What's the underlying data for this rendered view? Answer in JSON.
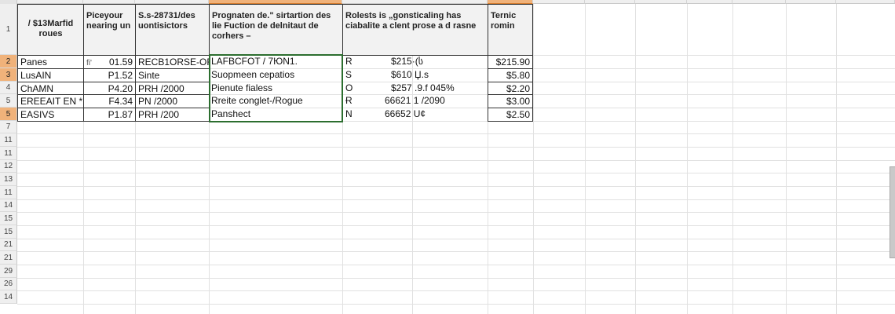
{
  "header_row": {
    "a": "/ $13Marfid roues",
    "b": "Piceyour nearing un",
    "c": "S.s-28731/des uontisictors",
    "d": "Prognaten de.\" sirtartion des lie Fuction de delnitaut de corhers –",
    "e": "Rolests is „gonsticaling has ciabalite a clent prose a d rasne",
    "f": "Ternic romin"
  },
  "row_numbers": [
    "1",
    "2",
    "3",
    "4",
    "5",
    "5",
    "7",
    "11",
    "11",
    "12",
    "13",
    "11",
    "14",
    "15",
    "15",
    "21",
    "21",
    "29",
    "26",
    "14"
  ],
  "rows": [
    {
      "a": "Panes",
      "b1": "ﬁ'",
      "b2": "01.59",
      "c": "RECB1ORSE-OF",
      "d": "LAFBCFOT / 7ЮN1.",
      "e1": "R",
      "e2": "$215·(ს",
      "f": "$215.90"
    },
    {
      "a": "LusAIN",
      "b1": "",
      "b2": "P1.52",
      "c": "Sinte",
      "d": "Suopmeen cepatios",
      "e1": "S",
      "e2": "$610 Џ.s",
      "f": "$5.80"
    },
    {
      "a": "ChAMN",
      "b1": "",
      "b2": "P4.20",
      "c": "PRH /2000",
      "d": "Pienute fialess",
      "e1": "O",
      "e2": "$257 .9.f 045%",
      "f": "$2.20"
    },
    {
      "a": "EREEAIT EN *",
      "b1": "",
      "b2": "F4.34",
      "c": "PN /2000",
      "d": "Rreite conglet-/Rogue",
      "e1": "Ɍ",
      "e2": "66621  1 /2090",
      "f": "$3.00"
    },
    {
      "a": "EASIVS",
      "b1": "",
      "b2": "P1.87",
      "c": "PRH /200",
      "d": "Panshect",
      "e1": "N",
      "e2": "66652 U¢",
      "f": "$2.50"
    }
  ],
  "colors": {
    "selection_border": "#2c6e2f",
    "header_highlight": "#f0b27a"
  }
}
